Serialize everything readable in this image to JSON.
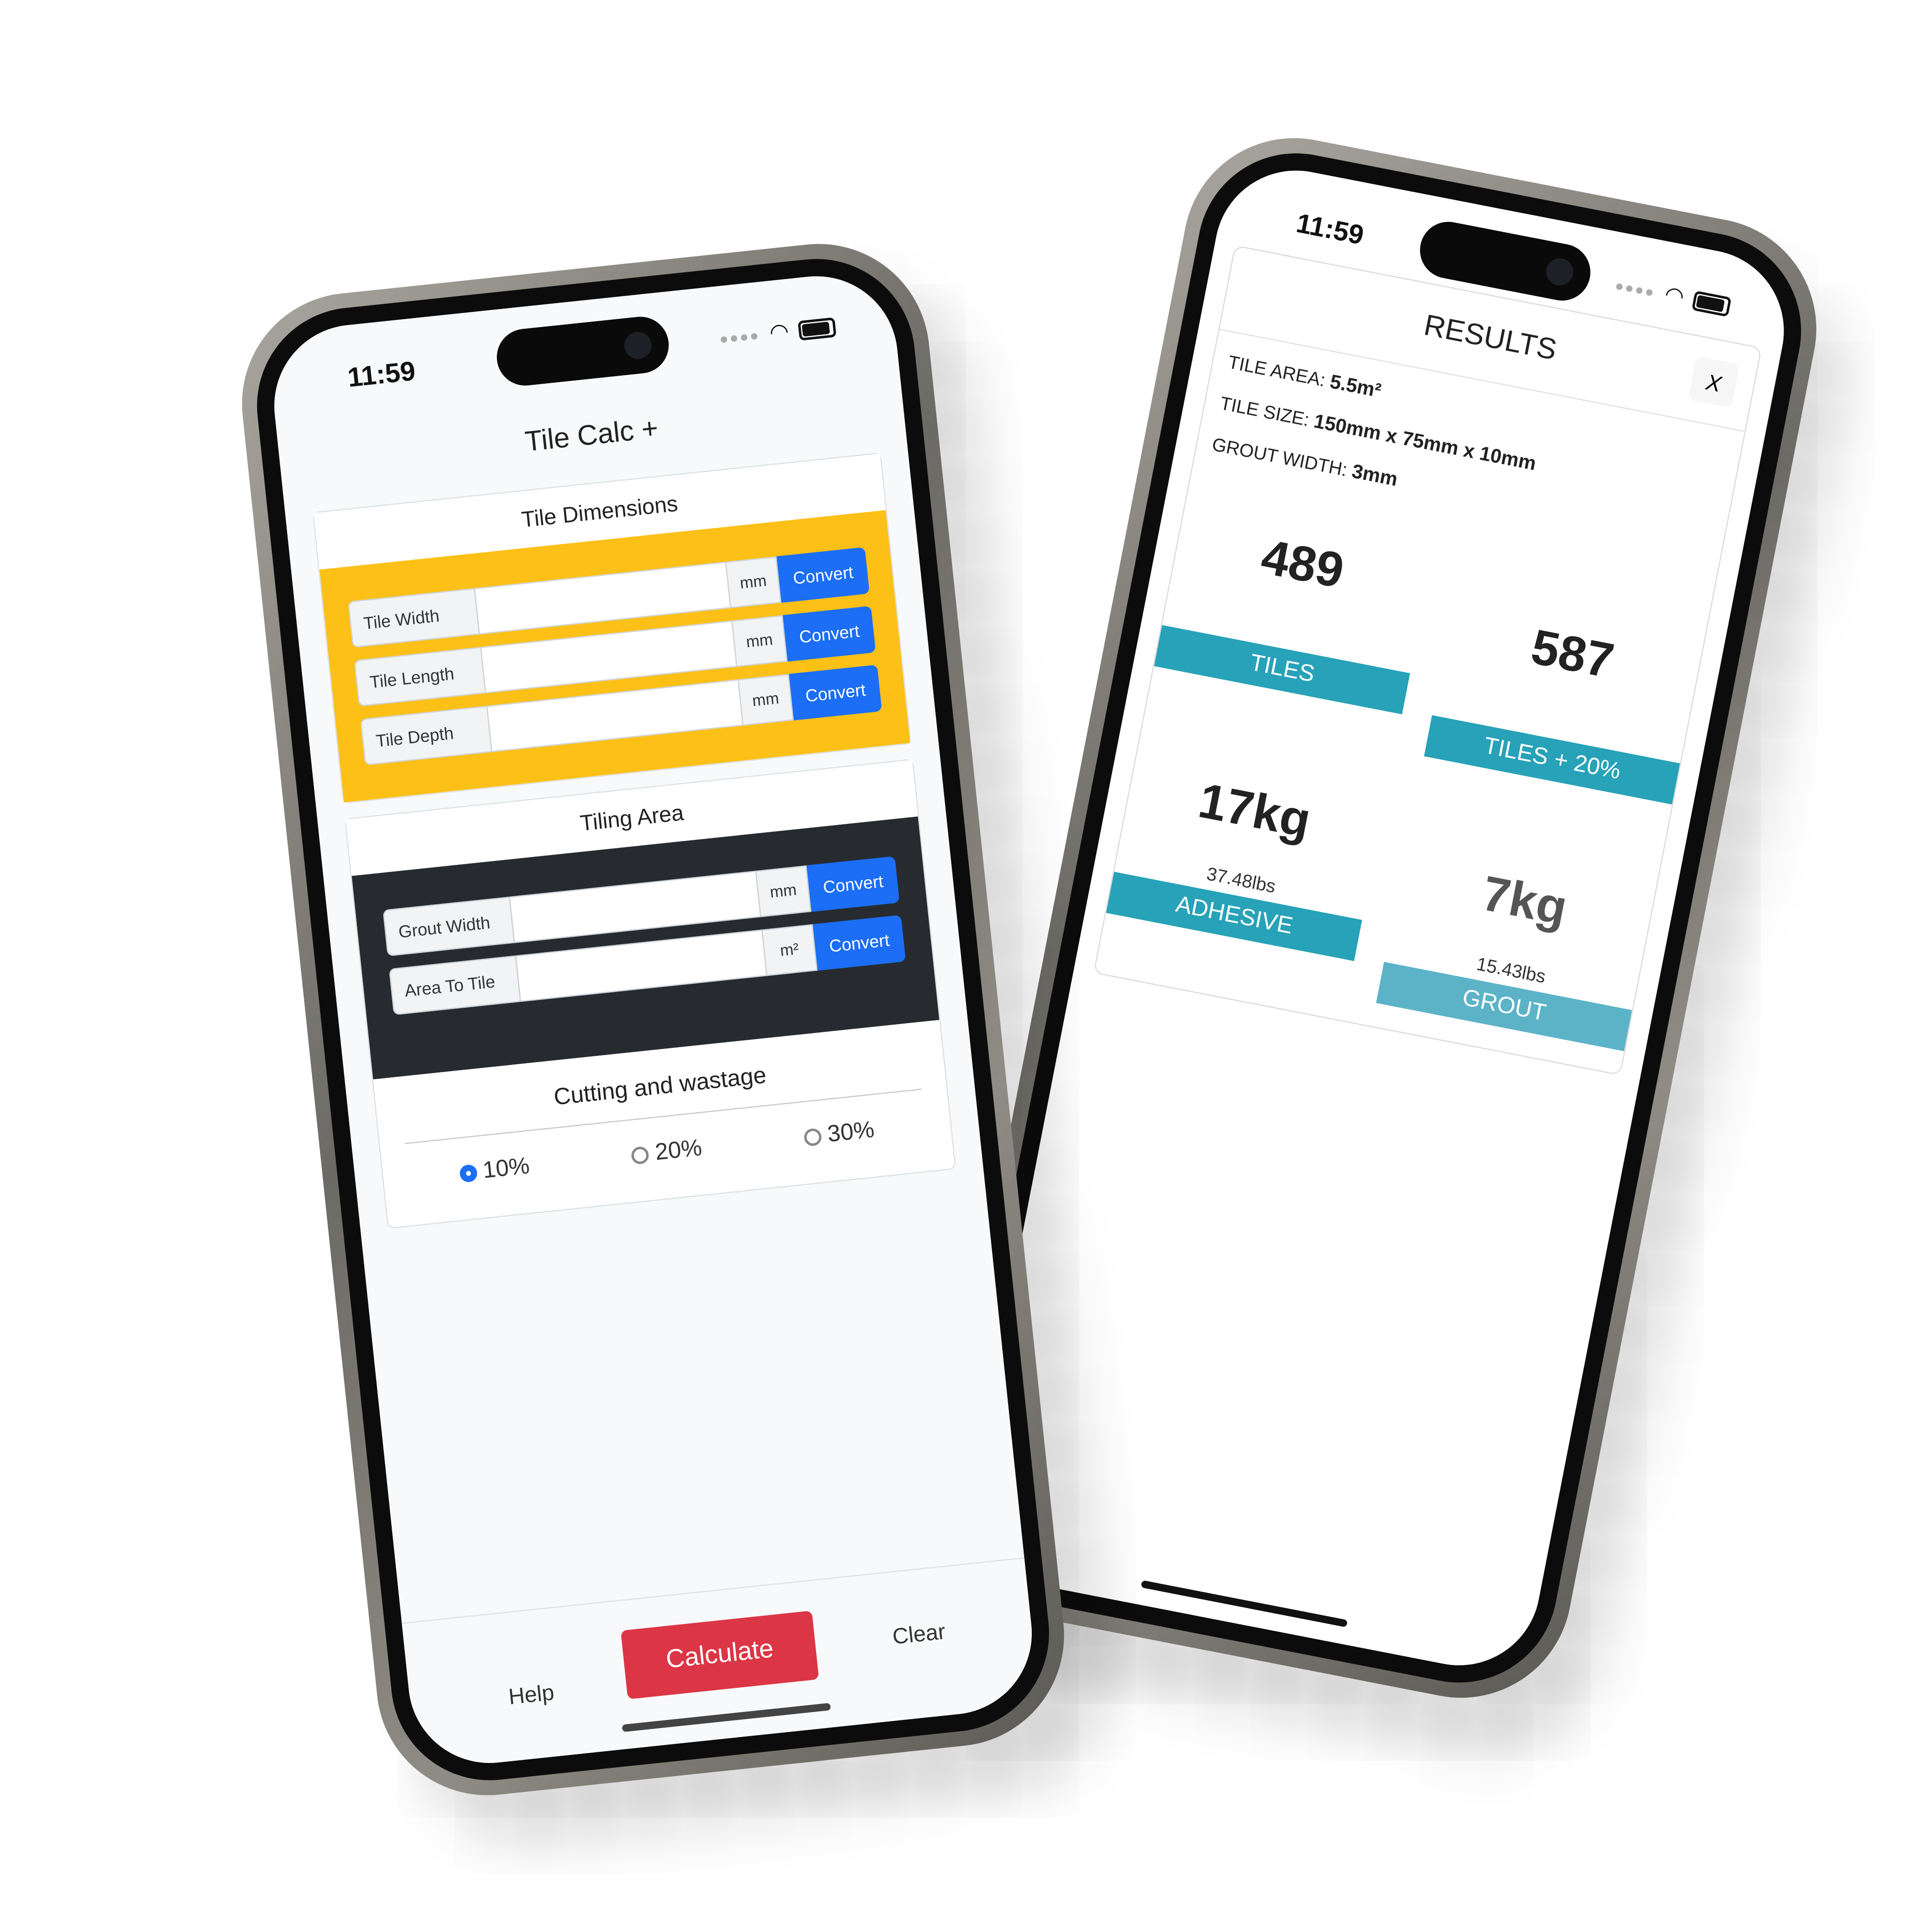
{
  "colors": {
    "accent_yellow": "#fdc016",
    "dark_panel": "#272b30",
    "button_blue": "#1b6ef5",
    "calculate_red": "#dc3545",
    "result_teal": "#27a2b8"
  },
  "status_bar": {
    "time": "11:59",
    "icons": [
      "cellular-dots-icon",
      "wifi-icon",
      "battery-icon"
    ]
  },
  "calculator": {
    "title": "Tile Calc +",
    "tile_dimensions": {
      "heading": "Tile Dimensions",
      "fields": [
        {
          "label": "Tile Width",
          "value": "",
          "unit": "mm",
          "button": "Convert"
        },
        {
          "label": "Tile Length",
          "value": "",
          "unit": "mm",
          "button": "Convert"
        },
        {
          "label": "Tile Depth",
          "value": "",
          "unit": "mm",
          "button": "Convert"
        }
      ]
    },
    "tiling_area": {
      "heading": "Tiling Area",
      "fields": [
        {
          "label": "Grout Width",
          "value": "",
          "unit": "mm",
          "button": "Convert"
        },
        {
          "label": "Area To Tile",
          "value": "",
          "unit": "m²",
          "button": "Convert"
        }
      ]
    },
    "wastage": {
      "heading": "Cutting and wastage",
      "options": [
        "10%",
        "20%",
        "30%"
      ],
      "selected": "10%"
    },
    "footer": {
      "help": "Help",
      "calculate": "Calculate",
      "clear": "Clear"
    }
  },
  "results": {
    "title": "RESULTS",
    "close": "X",
    "info": [
      {
        "label": "TILE AREA:",
        "value": "5.5m²"
      },
      {
        "label": "TILE SIZE:",
        "value": "150mm x 75mm x 10mm"
      },
      {
        "label": "GROUT WIDTH:",
        "value": "3mm"
      }
    ],
    "cards": [
      {
        "value": "489",
        "sub": "",
        "label": "TILES"
      },
      {
        "value": "587",
        "sub": "",
        "label": "TILES + 20%"
      },
      {
        "value": "17kg",
        "sub": "37.48lbs",
        "label": "ADHESIVE"
      },
      {
        "value": "7kg",
        "sub": "15.43lbs",
        "label": "GROUT"
      }
    ]
  }
}
